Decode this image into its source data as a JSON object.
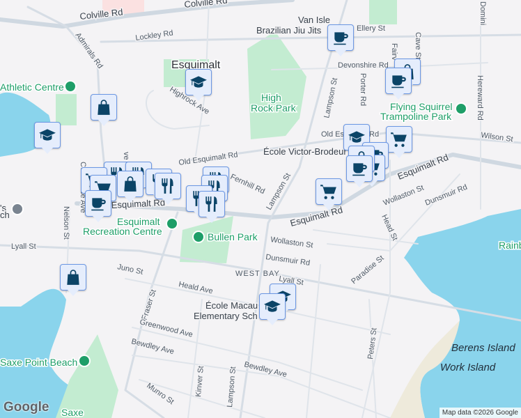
{
  "map": {
    "places": {
      "esquimalt": "Esquimalt",
      "west_bay": "WEST BAY"
    },
    "poi": {
      "athletic": "Athletic Centre",
      "van_isle_1": "Van Isle",
      "van_isle_2": "Brazilian Jiu Jits",
      "high_rock_1": "High",
      "high_rock_2": "Rock Park",
      "flying_1": "Flying Squirrel",
      "flying_2": "Trampoline Park",
      "rec_1": "Esquimalt",
      "rec_2": "Recreation Centre",
      "bullen": "Bullen Park",
      "victor": "École Victor-Brodeur",
      "macaulay_1": "École Macau",
      "macaulay_2": "Elementary Sch",
      "saxe_beach": "Saxe Point Beach",
      "saxe": "Saxe",
      "church": "'s",
      "church2": "ch",
      "rainbow": "Rainb"
    },
    "islands": {
      "berens": "Berens Island",
      "work": "Work Island"
    },
    "streets": {
      "colville1": "Colville Rd",
      "colville2": "Colville Rd",
      "admirals": "Admirals Rd",
      "lockley": "Lockley Rd",
      "highrock": "Highrock Ave",
      "old_esq": "Old Esquimalt Rd",
      "old_esq2": "Old Es",
      "old_esq3": "Rd",
      "fernhill": "Fernhill Rd",
      "esq_rd1": "Esquimalt Rd",
      "esq_rd2": "Esquimalt Rd",
      "esq_rd3": "Esquimalt Rd",
      "lampson1": "Lampson St",
      "lampson2": "Lampson St",
      "lampson3": "Lampson St",
      "ellery": "Ellery St",
      "devonshire": "Devonshire Rd",
      "porter": "Porter Rd",
      "fairview": "Fairv",
      "cave": "Cave St",
      "dominion": "Domini",
      "hereward": "Hereward Rd",
      "wilson": "Wilson St",
      "wollaston1": "Wollaston St",
      "wollaston2": "Wollaston St",
      "dunsmuir1": "Dunsmuir Rd",
      "dunsmuir2": "Dunsmuir Rd",
      "head": "Head St",
      "paradise": "Paradise St",
      "lyall1": "Lyall St",
      "lyall2": "Lyall St",
      "juno": "Juno St",
      "fraser": "Fraser St",
      "heald": "Heald Ave",
      "greenwood": "Greenwood Ave",
      "bewdley1": "Bewdley Ave",
      "bewdley2": "Bewdley Ave",
      "kinver": "Kinver St",
      "munro": "Munro St",
      "peters": "Peters St",
      "nelson": "Nelson St",
      "constance": "Constance Ave",
      "ave": "ve"
    },
    "logo": "Google",
    "attribution": "Map data ©2026 Google"
  }
}
